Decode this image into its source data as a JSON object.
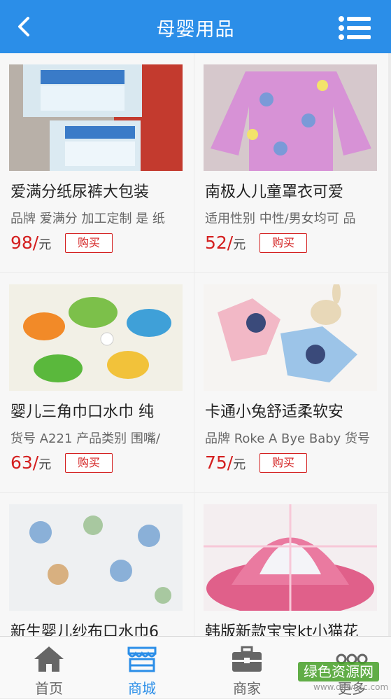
{
  "header": {
    "title": "母婴用品"
  },
  "products": [
    {
      "name": "爱满分纸尿裤大包装",
      "desc": "品牌 爱满分 加工定制 是 纸",
      "price": "98/",
      "unit": "元",
      "buy": "购买"
    },
    {
      "name": "南极人儿童罩衣可爱",
      "desc": "适用性别 中性/男女均可 品",
      "price": "52/",
      "unit": "元",
      "buy": "购买"
    },
    {
      "name": "婴儿三角巾口水巾 纯",
      "desc": "货号 A221 产品类别 围嘴/",
      "price": "63/",
      "unit": "元",
      "buy": "购买"
    },
    {
      "name": "卡通小兔舒适柔软安",
      "desc": "品牌 Roke A Bye Baby 货号",
      "price": "75/",
      "unit": "元",
      "buy": "购买"
    },
    {
      "name": "新生婴儿纱布口水巾6",
      "desc": "",
      "price": "",
      "unit": "",
      "buy": ""
    },
    {
      "name": "韩版新款宝宝kt小猫花",
      "desc": "",
      "price": "",
      "unit": "",
      "buy": ""
    }
  ],
  "tabs": [
    {
      "label": "首页",
      "icon": "home-icon"
    },
    {
      "label": "商城",
      "icon": "store-icon",
      "active": true
    },
    {
      "label": "商家",
      "icon": "briefcase-icon"
    },
    {
      "label": "更多",
      "icon": "more-icon"
    }
  ],
  "watermark": {
    "line1": "绿色资源网",
    "line2": "www.downcc.com"
  },
  "colors": {
    "accent": "#2b8ee8",
    "price": "#d42020"
  }
}
